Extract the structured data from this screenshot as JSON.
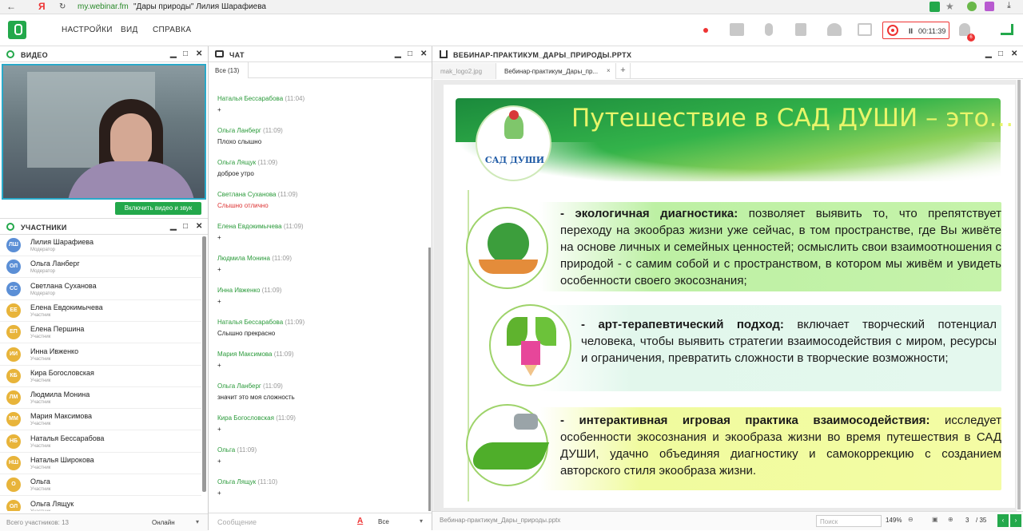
{
  "browser": {
    "url": "my.webinar.fm",
    "page_title": "\"Дары природы\" Лилия Шарафиева",
    "back_icon": "←",
    "yandex_icon": "Я",
    "reload_icon": "↻"
  },
  "menu": {
    "settings": "НАСТРОЙКИ",
    "view": "ВИД",
    "help": "СПРАВКА"
  },
  "recording": {
    "time": "00:11:39",
    "pause": "II"
  },
  "notif_badge": "6",
  "video": {
    "title": "ВИДЕО",
    "enable_button": "Включить видео и звук"
  },
  "participants": {
    "title": "УЧАСТНИКИ",
    "list": [
      {
        "initials": "ЛШ",
        "name": "Лилия Шарафиева",
        "role": "Модератор",
        "color": "#5b8fd6"
      },
      {
        "initials": "ОЛ",
        "name": "Ольга Ланберг",
        "role": "Модератор",
        "color": "#5b8fd6"
      },
      {
        "initials": "СС",
        "name": "Светлана Суханова",
        "role": "Модератор",
        "color": "#5b8fd6"
      },
      {
        "initials": "ЕЕ",
        "name": "Елена Евдокимычева",
        "role": "Участник",
        "color": "#e8b43a"
      },
      {
        "initials": "ЕП",
        "name": "Елена Першина",
        "role": "Участник",
        "color": "#e8b43a"
      },
      {
        "initials": "ИИ",
        "name": "Инна Ивженко",
        "role": "Участник",
        "color": "#e8b43a"
      },
      {
        "initials": "КБ",
        "name": "Кира Богословская",
        "role": "Участник",
        "color": "#e8b43a"
      },
      {
        "initials": "ЛМ",
        "name": "Людмила Монина",
        "role": "Участник",
        "color": "#e8b43a"
      },
      {
        "initials": "ММ",
        "name": "Мария Максимова",
        "role": "Участник",
        "color": "#e8b43a"
      },
      {
        "initials": "НБ",
        "name": "Наталья Бессарабова",
        "role": "Участник",
        "color": "#e8b43a"
      },
      {
        "initials": "НШ",
        "name": "Наталья Широкова",
        "role": "Участник",
        "color": "#e8b43a"
      },
      {
        "initials": "О",
        "name": "Ольга",
        "role": "Участник",
        "color": "#e8b43a"
      },
      {
        "initials": "ОЛ",
        "name": "Ольга Лящук",
        "role": "Участник",
        "color": "#e8b43a"
      }
    ],
    "total": "Всего участников: 13",
    "status": "Онлайн"
  },
  "chat": {
    "title": "ЧАТ",
    "tab": "Все (13)",
    "messages": [
      {
        "name": "Наталья Бессарабова",
        "time": "(11:04)",
        "text": "+"
      },
      {
        "name": "Ольга Ланберг",
        "time": "(11:09)",
        "text": "Плохо слышно"
      },
      {
        "name": "Ольга Лящук",
        "time": "(11:09)",
        "text": "доброе утро"
      },
      {
        "name": "Светлана Суханова",
        "time": "(11:09)",
        "text": "Слышно отлично"
      },
      {
        "name": "Елена Евдокимычева",
        "time": "(11:09)",
        "text": "+"
      },
      {
        "name": "Людмила Монина",
        "time": "(11:09)",
        "text": "+"
      },
      {
        "name": "Инна Ивженко",
        "time": "(11:09)",
        "text": "+"
      },
      {
        "name": "Наталья Бессарабова",
        "time": "(11:09)",
        "text": "Слышно прекрасно"
      },
      {
        "name": "Мария Максимова",
        "time": "(11:09)",
        "text": "+"
      },
      {
        "name": "Ольга Ланберг",
        "time": "(11:09)",
        "text": " значит это моя сложность"
      },
      {
        "name": "Кира Богословская",
        "time": "(11:09)",
        "text": "+"
      },
      {
        "name": "Ольга",
        "time": "(11:09)",
        "text": "+"
      },
      {
        "name": "Ольга Лящук",
        "time": "(11:10)",
        "text": "+"
      }
    ],
    "input_placeholder": "Сообщение",
    "filter": "Все"
  },
  "presentation": {
    "title": "ВЕБИНАР-ПРАКТИКУМ_ДАРЫ_ПРИРОДЫ.PPTX",
    "tabs": [
      "mak_logo2.jpg",
      "Вебинар-практикум_Дары_пр..."
    ],
    "tab_close": "×",
    "add_tab": "+",
    "footer_file": "Вебинар-практикум_Дары_природы.pptx",
    "search_placeholder": "Поиск",
    "zoom": "149%",
    "page": "3",
    "pages": "/ 35"
  },
  "slide": {
    "title": "Путешествие в САД ДУШИ – это…",
    "logo_text": "САД ДУШИ",
    "bullets": [
      {
        "bold": "- экологичная диагностика:",
        "text": " позволяет выявить то, что препятствует переходу на экообраз жизни уже сейчас, в том пространстве, где Вы живёте на основе личных и семейных ценностей; осмыслить свои взаимоотношения  с природой - с самим собой и с пространством, в котором мы живём и увидеть особенности своего экосознания;"
      },
      {
        "bold": "- арт-терапевтический подход:",
        "text": " включает творческий потенциал человека, чтобы выявить стратегии взаимосодействия с миром, ресурсы и ограничения, превратить сложности в творческие возможности;"
      },
      {
        "bold": "- интерактивная игровая практика взаимосодействия:",
        "text": " исследует особенности экосознания и экообраза жизни  во время путешествия в САД ДУШИ, удачно объединяя диагностику и самокоррекцию с созданием авторского стиля экообраза жизни."
      }
    ]
  },
  "colors": {
    "accent": "#23a84b",
    "record": "#e33333",
    "slide_green": "#2aa84a"
  }
}
